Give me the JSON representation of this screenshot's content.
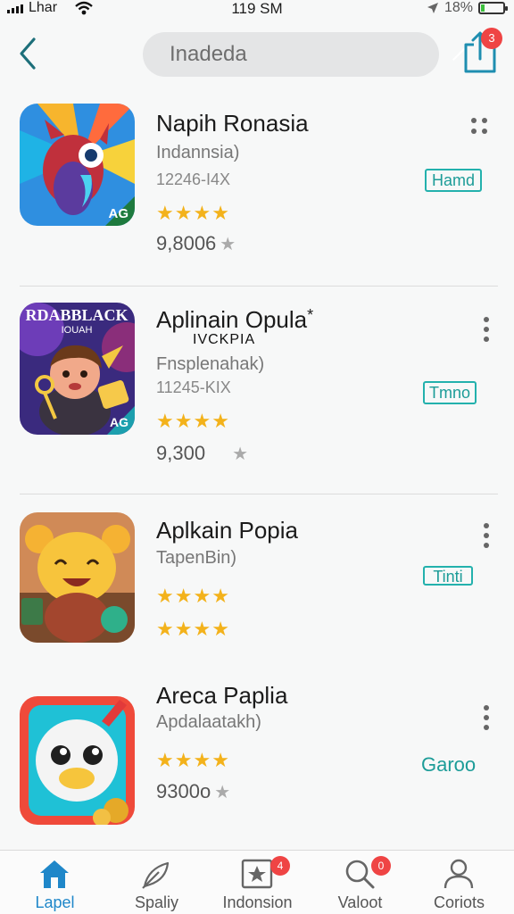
{
  "status": {
    "carrier": "Lhar",
    "time": "119 SM",
    "battery": "18%",
    "battery_level": 0.18
  },
  "header": {
    "search_value": "Inadeda",
    "share_badge": "3"
  },
  "apps": [
    {
      "name": "Napih Ronasia",
      "subtitle": "Indannsia)",
      "meta": "12246-I4X",
      "rating_rows": [
        3.5
      ],
      "count": "9,8006",
      "button": "Hamd",
      "button_style": "boxed"
    },
    {
      "name": "Aplinain Opula",
      "name_suffix": "*",
      "name_extra": "IVCKPIA",
      "subtitle": "Fnsplenahak)",
      "meta": "11245-KIX",
      "rating_rows": [
        3.5
      ],
      "count": "9,300",
      "button": "Tmno",
      "button_style": "boxed",
      "icon_caption": "RDABBLACK",
      "icon_caption2": "IOUAH"
    },
    {
      "name": "Aplkain Popia",
      "subtitle": "TapenBin)",
      "meta": "",
      "rating_rows": [
        3.5,
        3.5
      ],
      "count": "",
      "button": "Tinti",
      "button_style": "boxed"
    },
    {
      "name": "Areca Paplia",
      "subtitle": "Apdalaatakh)",
      "meta": "",
      "rating_rows": [
        3.5
      ],
      "count": "9300o",
      "button": "Garoo",
      "button_style": "plain"
    }
  ],
  "tabs": [
    {
      "label": "Lapel",
      "icon": "home-icon",
      "active": true,
      "badge": ""
    },
    {
      "label": "Spaliy",
      "icon": "feather-icon",
      "active": false,
      "badge": ""
    },
    {
      "label": "Indonsion",
      "icon": "star-box-icon",
      "active": false,
      "badge": "4"
    },
    {
      "label": "Valoot",
      "icon": "search-icon",
      "active": false,
      "badge": "0"
    },
    {
      "label": "Coriots",
      "icon": "profile-icon",
      "active": false,
      "badge": ""
    }
  ],
  "colors": {
    "accent": "#1f87c9",
    "button_teal": "#23b1ad",
    "star": "#f3b21b",
    "badge": "#ef4444"
  }
}
